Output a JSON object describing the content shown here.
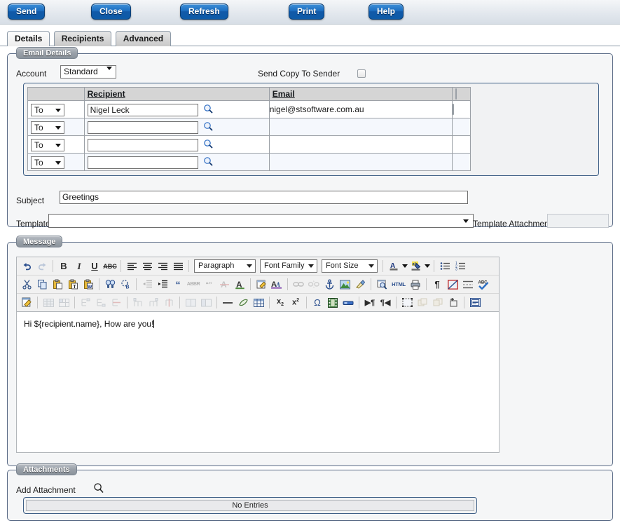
{
  "toolbar": {
    "buttons": [
      {
        "id": "send",
        "label": "Send"
      },
      {
        "id": "close",
        "label": "Close"
      },
      {
        "id": "refresh",
        "label": "Refresh"
      },
      {
        "id": "print",
        "label": "Print"
      },
      {
        "id": "help",
        "label": "Help"
      }
    ]
  },
  "tabs": [
    {
      "label": "Details",
      "active": true
    },
    {
      "label": "Recipients",
      "active": false
    },
    {
      "label": "Advanced",
      "active": false
    }
  ],
  "email_details": {
    "legend": "Email Details",
    "account_label": "Account",
    "account_value": "Standard",
    "account_edit_icon": "edit-pencil-icon",
    "account_new_icon": "new-star-icon",
    "send_copy_label": "Send Copy To Sender",
    "send_copy_checked": false,
    "grid": {
      "headers": [
        "",
        "Recipient",
        "Email",
        ""
      ],
      "rows": [
        {
          "type": "To",
          "recipient": "Nigel Leck",
          "email": "nigel@stsoftware.com.au",
          "checked": false
        },
        {
          "type": "To",
          "recipient": "",
          "email": "",
          "checked": false
        },
        {
          "type": "To",
          "recipient": "",
          "email": "",
          "checked": false
        },
        {
          "type": "To",
          "recipient": "",
          "email": "",
          "checked": false
        }
      ]
    },
    "subject_label": "Subject",
    "subject_value": "Greetings",
    "template_label": "Template",
    "template_value": "",
    "template_attachment_label": "Template Attachment",
    "template_attachment_value": ""
  },
  "message": {
    "legend": "Message",
    "selects": {
      "paragraph": "Paragraph",
      "font_family": "Font Family",
      "font_size": "Font Size"
    },
    "toolbar_row1": [
      "undo-icon",
      "redo-icon",
      "sep",
      "bold-icon",
      "italic-icon",
      "underline-icon",
      "strikethrough-icon",
      "sep",
      "align-left-icon",
      "align-center-icon",
      "align-right-icon",
      "align-justify-icon",
      "sep",
      "paragraph-select",
      "font-family-select",
      "font-size-select",
      "sep",
      "text-color-icon",
      "text-color-caret",
      "highlight-color-icon",
      "highlight-color-caret",
      "sep",
      "bullet-list-icon",
      "numbered-list-icon"
    ],
    "toolbar_row2": [
      "cut-icon",
      "copy-icon",
      "paste-icon",
      "paste-text-icon",
      "paste-word-icon",
      "sep",
      "find-icon",
      "find-replace-icon",
      "sep",
      "outdent-icon",
      "indent-icon",
      "blockquote-icon",
      "abbreviation-icon",
      "citation-icon",
      "delete-formatting-icon",
      "select-all-icon",
      "sep",
      "edit-note-icon",
      "font-style-icon",
      "sep",
      "insert-link-icon",
      "unlink-icon",
      "anchor-icon",
      "insert-image-icon",
      "cleanup-icon",
      "sep",
      "preview-icon",
      "html-source-icon",
      "print-icon",
      "sep",
      "show-paragraph-icon",
      "toggle-guidelines-icon",
      "insert-page-break-icon",
      "spellcheck-icon"
    ],
    "toolbar_row3": [
      "edit-document-icon",
      "sep",
      "table-properties-icon",
      "cell-properties-icon",
      "sep",
      "insert-row-before-icon",
      "insert-row-after-icon",
      "delete-row-icon",
      "sep",
      "insert-column-before-icon",
      "insert-column-after-icon",
      "delete-column-icon",
      "sep",
      "split-cells-icon",
      "merge-cells-icon",
      "sep",
      "horizontal-rule-icon",
      "remove-format-icon",
      "insert-table-icon",
      "sep",
      "subscript-icon",
      "superscript-icon",
      "sep",
      "special-character-icon",
      "insert-media-icon",
      "insert-layer-icon",
      "sep",
      "ltr-icon",
      "rtl-icon",
      "sep",
      "visual-aid-icon",
      "move-forward-icon",
      "move-backward-icon",
      "insert-layer-new-icon",
      "sep",
      "fullscreen-icon"
    ],
    "body_text": "Hi ${recipient.name}, How are you!"
  },
  "attachments": {
    "legend": "Attachments",
    "add_label": "Add Attachment",
    "search_icon": "search-icon",
    "empty_text": "No Entries"
  },
  "colors": {
    "button_blue": "#1259a8",
    "panel_border": "#5a6b86",
    "grid_header": "#d5d5d5",
    "row_alt": "#f5f8fd"
  }
}
